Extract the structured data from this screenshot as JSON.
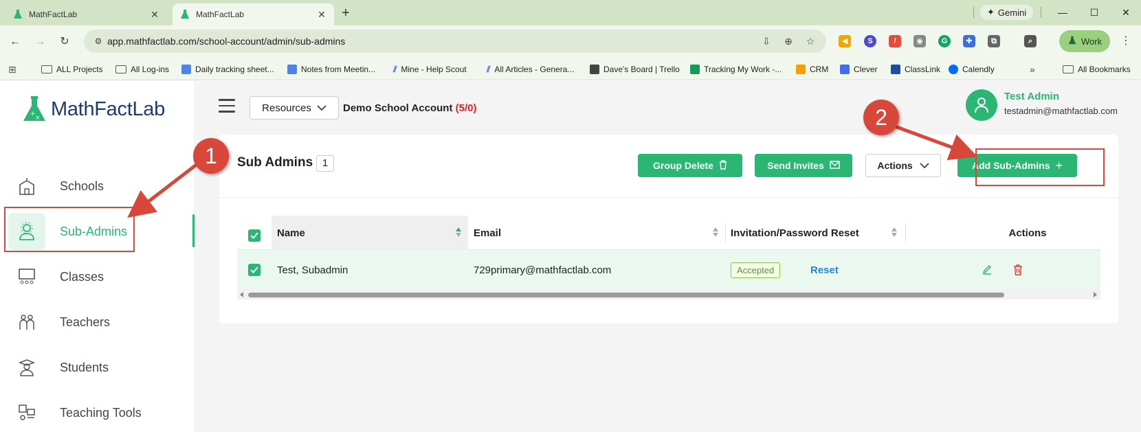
{
  "browser": {
    "tabs": [
      {
        "title": "MathFactLab",
        "active": false
      },
      {
        "title": "MathFactLab",
        "active": true
      }
    ],
    "gemini_label": "Gemini",
    "url": "app.mathfactlab.com/school-account/admin/sub-admins",
    "profile_label": "Work",
    "bookmarks": [
      {
        "label": "ALL Projects",
        "icon": "folder-icon"
      },
      {
        "label": "All Log-ins",
        "icon": "folder-icon"
      },
      {
        "label": "Daily tracking sheet...",
        "icon": "docs-icon"
      },
      {
        "label": "Notes from Meetin...",
        "icon": "docs-icon"
      },
      {
        "label": "Mine - Help Scout",
        "icon": "helpscout-icon"
      },
      {
        "label": "All Articles - Genera...",
        "icon": "helpscout-icon"
      },
      {
        "label": "Dave's Board | Trello",
        "icon": "trello-icon"
      },
      {
        "label": "Tracking My Work -...",
        "icon": "sheets-icon"
      },
      {
        "label": "CRM",
        "icon": "crm-icon"
      },
      {
        "label": "Clever",
        "icon": "clever-icon"
      },
      {
        "label": "ClassLink",
        "icon": "classlink-icon"
      },
      {
        "label": "Calendly",
        "icon": "calendly-icon"
      }
    ],
    "all_bookmarks_label": "All Bookmarks"
  },
  "app": {
    "logo_text": "MathFactLab",
    "sidebar": {
      "items": [
        {
          "label": "Schools",
          "icon": "school-icon",
          "active": false
        },
        {
          "label": "Sub-Admins",
          "icon": "sub-admin-icon",
          "active": true
        },
        {
          "label": "Classes",
          "icon": "classroom-icon",
          "active": false
        },
        {
          "label": "Teachers",
          "icon": "teachers-icon",
          "active": false
        },
        {
          "label": "Students",
          "icon": "student-icon",
          "active": false
        },
        {
          "label": "Teaching Tools",
          "icon": "teaching-tools-icon",
          "active": false
        }
      ]
    },
    "header": {
      "resources_label": "Resources",
      "account_name": "Demo School Account",
      "account_count": "(5/0)",
      "user_name": "Test Admin",
      "user_email": "testadmin@mathfactlab.com"
    },
    "page": {
      "title": "Sub Admins",
      "count": "1",
      "group_delete_label": "Group Delete",
      "send_invites_label": "Send Invites",
      "actions_label": "Actions",
      "add_label": "Add Sub-Admins"
    },
    "table": {
      "headers": {
        "name": "Name",
        "email": "Email",
        "invitation": "Invitation/Password Reset",
        "actions": "Actions"
      },
      "rows": [
        {
          "name": "Test, Subadmin",
          "email": "729primary@mathfactlab.com",
          "status": "Accepted",
          "reset": "Reset"
        }
      ]
    }
  },
  "annotations": {
    "step1": "1",
    "step2": "2"
  },
  "colors": {
    "accent": "#2bb673",
    "annotation": "#d9473b",
    "link": "#1e88e5",
    "count_red": "#e02020"
  }
}
